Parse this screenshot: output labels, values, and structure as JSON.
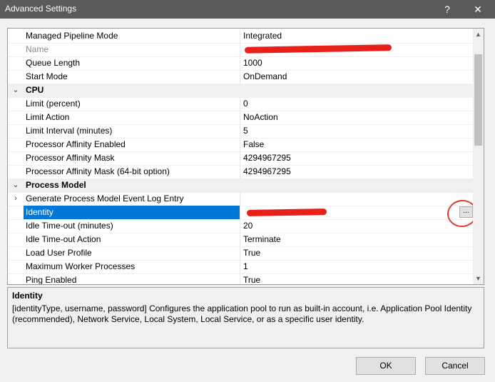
{
  "window": {
    "title": "Advanced Settings",
    "help_glyph": "?",
    "close_glyph": "✕"
  },
  "properties": [
    {
      "type": "prop",
      "name": "Managed Pipeline Mode",
      "value": "Integrated"
    },
    {
      "type": "prop",
      "name": "Name",
      "value": "",
      "disabled": true,
      "redacted": true
    },
    {
      "type": "prop",
      "name": "Queue Length",
      "value": "1000"
    },
    {
      "type": "prop",
      "name": "Start Mode",
      "value": "OnDemand"
    },
    {
      "type": "category",
      "name": "CPU",
      "expanded": true
    },
    {
      "type": "prop",
      "name": "Limit (percent)",
      "value": "0"
    },
    {
      "type": "prop",
      "name": "Limit Action",
      "value": "NoAction"
    },
    {
      "type": "prop",
      "name": "Limit Interval (minutes)",
      "value": "5"
    },
    {
      "type": "prop",
      "name": "Processor Affinity Enabled",
      "value": "False"
    },
    {
      "type": "prop",
      "name": "Processor Affinity Mask",
      "value": "4294967295"
    },
    {
      "type": "prop",
      "name": "Processor Affinity Mask (64-bit option)",
      "value": "4294967295"
    },
    {
      "type": "category",
      "name": "Process Model",
      "expanded": true
    },
    {
      "type": "prop",
      "name": "Generate Process Model Event Log Entry",
      "value": "",
      "collapsed": true
    },
    {
      "type": "prop",
      "name": "Identity",
      "value": "",
      "selected": true,
      "redacted": true
    },
    {
      "type": "prop",
      "name": "Idle Time-out (minutes)",
      "value": "20"
    },
    {
      "type": "prop",
      "name": "Idle Time-out Action",
      "value": "Terminate"
    },
    {
      "type": "prop",
      "name": "Load User Profile",
      "value": "True"
    },
    {
      "type": "prop",
      "name": "Maximum Worker Processes",
      "value": "1"
    },
    {
      "type": "prop",
      "name": "Ping Enabled",
      "value": "True"
    }
  ],
  "ellipsis_label": "...",
  "description": {
    "title": "Identity",
    "text": "[identityType, username, password] Configures the application pool to run as built-in account, i.e. Application Pool Identity (recommended), Network Service, Local System, Local Service, or as a specific user identity."
  },
  "buttons": {
    "ok": "OK",
    "cancel": "Cancel"
  },
  "colors": {
    "selection": "#0078d7",
    "titlebar": "#5a5a5a",
    "annotation": "#e23a3a"
  }
}
